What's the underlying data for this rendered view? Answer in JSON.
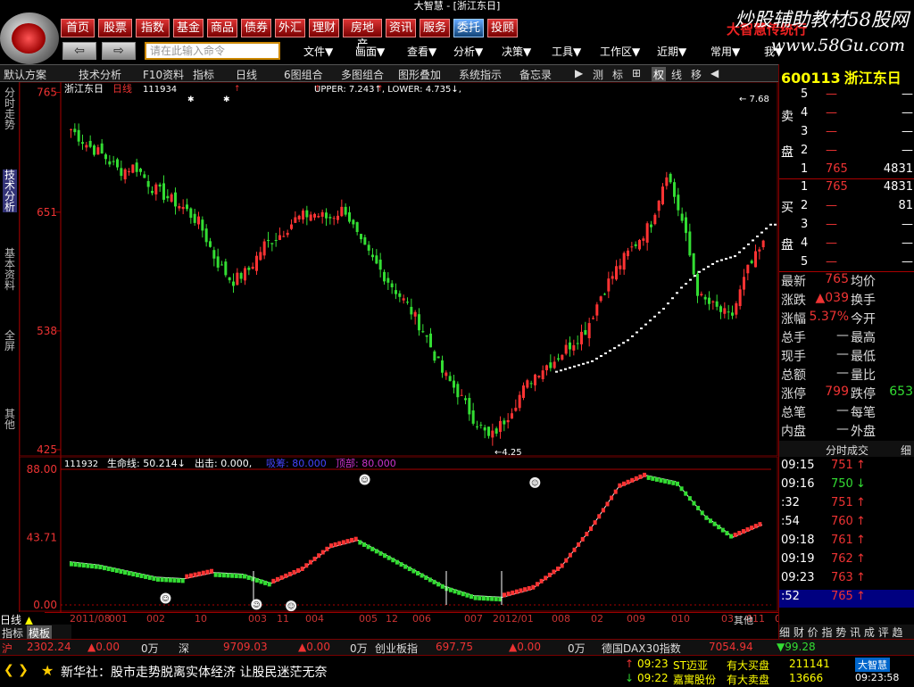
{
  "app": {
    "title": "大智慧 - [浙江东日]"
  },
  "menu": {
    "items": [
      "首页",
      "股票",
      "指数",
      "基金",
      "商品",
      "债券",
      "外汇",
      "理财",
      "房地产",
      "资讯",
      "服务",
      "委托",
      "投顾"
    ],
    "highlight_index": 11
  },
  "toolbar": {
    "back": "⇦",
    "forward": "⇨",
    "cmd_placeholder": "请在此输入命令",
    "dropdowns": [
      "文件",
      "画面",
      "查看",
      "分析",
      "决策",
      "工具",
      "工作区",
      "近期",
      "常用",
      "我"
    ],
    "brand": "大智慧传统行"
  },
  "watermark": {
    "line1": "炒股辅助教材58股网",
    "line2": "www.58Gu.com"
  },
  "subtabs": [
    "默认方案",
    "技术分析",
    "F10资料",
    "指标",
    "日线",
    "6图组合",
    "多图组合",
    "图形叠加",
    "系统指示",
    "备忘录",
    "▶",
    "测",
    "标",
    "⊞",
    "权",
    "线",
    "移",
    "◀"
  ],
  "leftnav": [
    "分时走势",
    "技术分析",
    "基本资料",
    "全屏",
    "其他"
  ],
  "leftnav_active": 1,
  "bottom": {
    "tab1": "日线",
    "tab2": "指标",
    "tab3": "模板"
  },
  "mainchart": {
    "stock_label": "浙江东日",
    "period": "日线",
    "date_code": "111934",
    "indicator_line": "UPPER: 7.243↑, LOWER: 4.735↓,",
    "y_labels": [
      "765",
      "651",
      "538",
      "425"
    ],
    "low_marker": "4.25",
    "high_marker": "7.68"
  },
  "indicator": {
    "header_code": "111932",
    "name": "生命线: 50.214↓",
    "exit": "出击: 0.000,",
    "extra1": "吸筹: 80.000",
    "extra2": "顶部: 80.000",
    "y_labels": [
      "88.00",
      "43.71",
      "0.00"
    ]
  },
  "xaxis": {
    "labels": [
      "2011/08",
      "001",
      "002",
      "10",
      "003",
      "11",
      "004",
      "005",
      "12",
      "006",
      "007",
      "2012/01",
      "008",
      "02",
      "009",
      "010",
      "03",
      "011",
      "其他",
      "04"
    ]
  },
  "rightpanel": {
    "code": "600113",
    "name": "浙江东日",
    "sell": [
      {
        "n": "5",
        "p": "—",
        "v": "—"
      },
      {
        "n": "4",
        "p": "—",
        "v": "—"
      },
      {
        "n": "3",
        "p": "—",
        "v": "—"
      },
      {
        "n": "2",
        "p": "—",
        "v": "—"
      },
      {
        "n": "1",
        "p": "765",
        "v": "4831"
      }
    ],
    "buy": [
      {
        "n": "1",
        "p": "765",
        "v": "4831"
      },
      {
        "n": "2",
        "p": "—",
        "v": "81"
      },
      {
        "n": "3",
        "p": "—",
        "v": "—"
      },
      {
        "n": "4",
        "p": "—",
        "v": "—"
      },
      {
        "n": "5",
        "p": "—",
        "v": "—"
      }
    ],
    "sell_label": [
      "卖",
      "盘"
    ],
    "buy_label": [
      "买",
      "盘"
    ],
    "stats": [
      {
        "l": "最新",
        "v": "765",
        "l2": "均价",
        "v2": ""
      },
      {
        "l": "涨跌",
        "v": "▲039",
        "l2": "换手",
        "v2": ""
      },
      {
        "l": "涨幅",
        "v": "5.37%",
        "l2": "今开",
        "v2": ""
      },
      {
        "l": "总手",
        "v": "—",
        "l2": "最高",
        "v2": ""
      },
      {
        "l": "现手",
        "v": "—",
        "l2": "最低",
        "v2": ""
      },
      {
        "l": "总额",
        "v": "—",
        "l2": "量比",
        "v2": ""
      },
      {
        "l": "涨停",
        "v": "799",
        "l2": "跌停",
        "v2": "653"
      },
      {
        "l": "总笔",
        "v": "—",
        "l2": "每笔",
        "v2": ""
      },
      {
        "l": "内盘",
        "v": "—",
        "l2": "外盘",
        "v2": ""
      }
    ],
    "ticks_header": "分时成交",
    "ticks_header2": "细",
    "ticks": [
      {
        "t": "09:15",
        "p": "751",
        "d": "up"
      },
      {
        "t": "09:16",
        "p": "750",
        "d": "down"
      },
      {
        "t": ":32",
        "p": "751",
        "d": "up"
      },
      {
        "t": ":54",
        "p": "760",
        "d": "up"
      },
      {
        "t": "09:18",
        "p": "761",
        "d": "up"
      },
      {
        "t": "09:19",
        "p": "762",
        "d": "up"
      },
      {
        "t": "09:23",
        "p": "763",
        "d": "up"
      },
      {
        "t": ":52",
        "p": "765",
        "d": "up"
      }
    ],
    "bottom_tabs": "细 财 价 指 势 讯 成 评 趋"
  },
  "statusbar": {
    "idx1_label": "沪",
    "idx1_val": "2302.24",
    "idx1_chg": "▲0.00",
    "idx1_vol": "0万",
    "idx2_label": "深",
    "idx2_val": "9709.03",
    "idx2_chg": "▲0.00",
    "idx2_vol": "0万",
    "idx3_label": "创业板指",
    "idx3_val": "697.75",
    "idx3_chg": "▲0.00",
    "idx3_vol": "0万",
    "idx4_label": "德国DAX30指数",
    "idx4_val": "7054.94",
    "idx4_chg": "▼99.28"
  },
  "news": {
    "headline": "新华社：股市走势脱离实体经济 让股民迷茫无奈",
    "alert1": {
      "time": "09:23",
      "stock": "ST迈亚",
      "type": "有大买盘",
      "vol": "211141"
    },
    "alert2": {
      "time": "09:22",
      "stock": "嘉寓股份",
      "type": "有大卖盘",
      "vol": "13666"
    },
    "logo": "大智慧",
    "clock": "09:23:58"
  },
  "colors": {
    "up": "#ff3333",
    "down": "#33dd33",
    "axis": "#aa0000",
    "white": "#ffffff",
    "yellow": "#ffff00"
  },
  "chart_data": [
    {
      "type": "candlestick",
      "title": "浙江东日 日线",
      "ylim": [
        4.25,
        7.68
      ],
      "y_ticks": [
        7.65,
        6.51,
        5.38,
        4.25
      ],
      "close_path": [
        7.3,
        7.15,
        7.05,
        6.9,
        6.95,
        6.75,
        6.65,
        6.55,
        6.4,
        6.05,
        5.85,
        5.95,
        6.2,
        6.3,
        6.45,
        6.5,
        6.45,
        6.55,
        6.2,
        6.0,
        5.8,
        5.6,
        5.35,
        5.0,
        4.8,
        4.55,
        4.35,
        4.55,
        4.8,
        5.0,
        5.1,
        5.25,
        5.4,
        5.75,
        6.0,
        6.2,
        6.4,
        6.9,
        6.4,
        5.7,
        5.6,
        5.5,
        5.95,
        6.2
      ],
      "band_lower": [
        5.0,
        5.05,
        5.1,
        5.2,
        5.3,
        5.45,
        5.6,
        5.8,
        5.95,
        6.05,
        6.1,
        6.25,
        6.4
      ]
    },
    {
      "type": "line",
      "title": "生命线",
      "ylim": [
        0,
        88
      ],
      "series": [
        {
          "name": "生命线",
          "values": [
            28,
            26,
            22,
            18,
            17,
            21,
            20,
            14,
            22,
            37,
            42,
            32,
            22,
            12,
            6,
            5,
            10,
            24,
            48,
            76,
            84,
            80,
            58,
            44,
            52
          ]
        }
      ]
    }
  ]
}
